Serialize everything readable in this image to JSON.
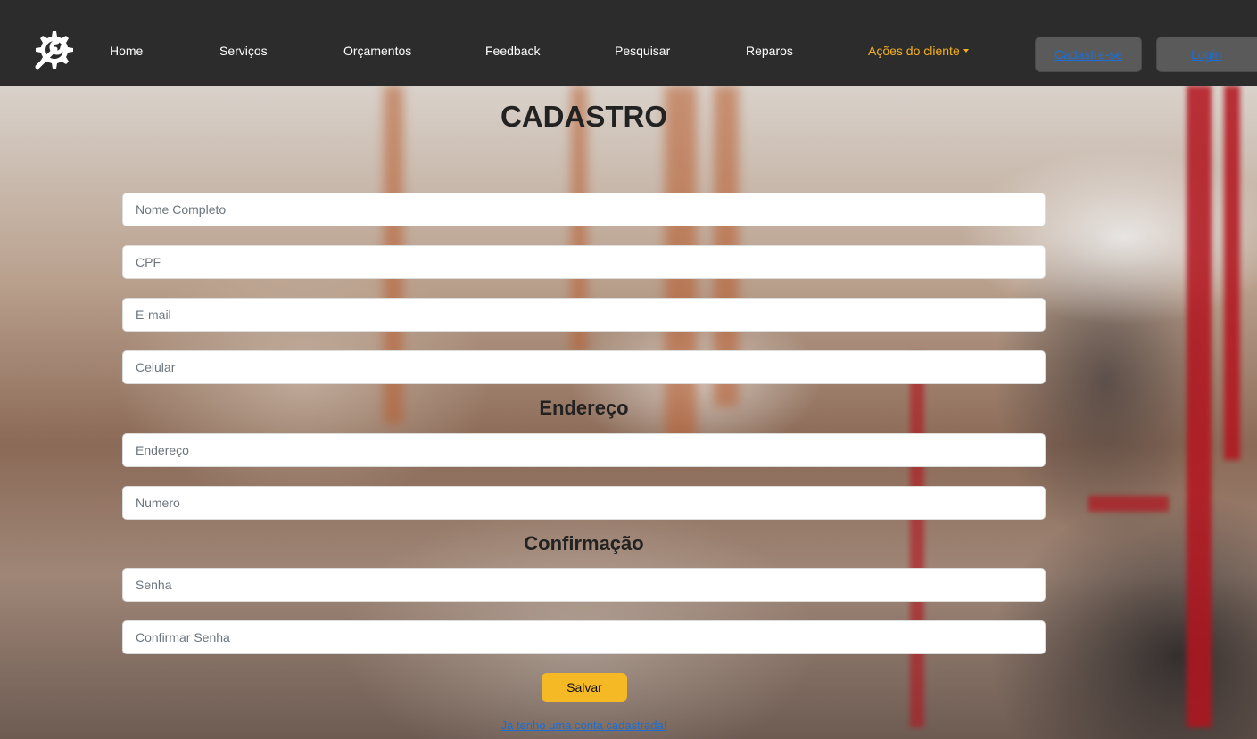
{
  "nav": {
    "logo_icon": "gear-wrench-icon",
    "links": [
      "Home",
      "Serviços",
      "Orçamentos",
      "Feedback",
      "Pesquisar",
      "Reparos"
    ],
    "dropdown_label": "Ações do cliente",
    "signup_label": "Cadastre-se",
    "login_label": "Login",
    "accent_color": "#f5b120"
  },
  "form": {
    "title": "CADASTRO",
    "fields_personal": {
      "name_placeholder": "Nome Completo",
      "cpf_placeholder": "CPF",
      "email_placeholder": "E-mail",
      "phone_placeholder": "Celular"
    },
    "address_title": "Endereço",
    "fields_address": {
      "street_placeholder": "Endereço",
      "number_placeholder": "Numero"
    },
    "confirm_title": "Confirmação",
    "fields_confirm": {
      "password_placeholder": "Senha",
      "confirm_password_placeholder": "Confirmar Senha"
    },
    "save_label": "Salvar",
    "save_color": "#f5b925",
    "account_link": "Ja tenho uma conta cadastrada!"
  }
}
